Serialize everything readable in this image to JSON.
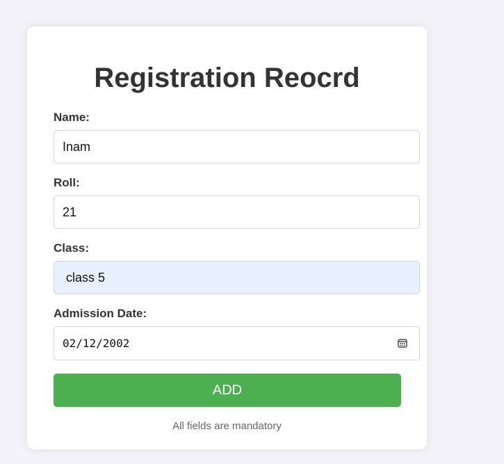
{
  "form": {
    "title": "Registration Reocrd",
    "fields": {
      "name": {
        "label": "Name:",
        "value": "Inam"
      },
      "roll": {
        "label": "Roll:",
        "value": "21"
      },
      "class": {
        "label": "Class:",
        "value": "class 5"
      },
      "admission_date": {
        "label": "Admission Date:",
        "value": "02/12/2002",
        "icon": "calendar-icon"
      }
    },
    "submit_label": "ADD",
    "note": "All fields are mandatory"
  },
  "colors": {
    "page_background": "#f3f3f9",
    "card_background": "#ffffff",
    "button": "#4caf50",
    "autofill_field": "#e8f0fe",
    "text": "#333333"
  }
}
